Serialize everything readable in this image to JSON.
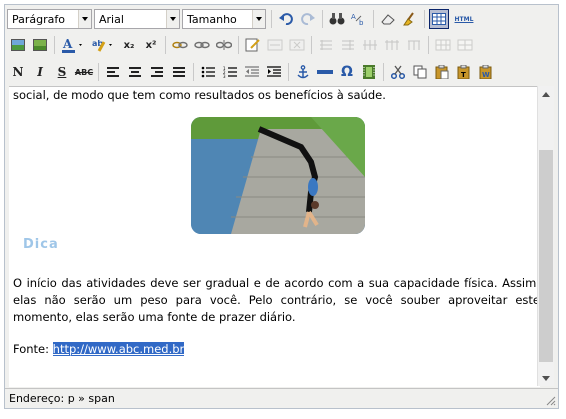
{
  "toolbar": {
    "format_select": "Parágrafo",
    "font_select": "Arial",
    "size_select": "Tamanho",
    "html_label": "HTML",
    "bold_label": "N",
    "italic_label": "I",
    "underline_label": "S",
    "strike_label": "ABC",
    "omega_label": "Ω",
    "subscript_label": "x₂",
    "superscript_label": "x²"
  },
  "content": {
    "top_text": "social, de modo que tem como resultados os benefícios à saúde.",
    "dica": "Dica",
    "para_line1": "O início das atividades deve ser gradual e de acordo com a sua capacidade física. Assim,",
    "para_line2": "elas não serão um peso para você. Pelo contrário, se você souber aproveitar este",
    "para_line3": "momento, elas serão uma fonte de prazer diário.",
    "fonte_label": "Fonte: ",
    "fonte_link": "http://www.abc.med.br"
  },
  "status": {
    "path": "Endereço: p » span"
  },
  "colors": {
    "selection": "#3169c6",
    "dica": "#9fc6e8"
  }
}
